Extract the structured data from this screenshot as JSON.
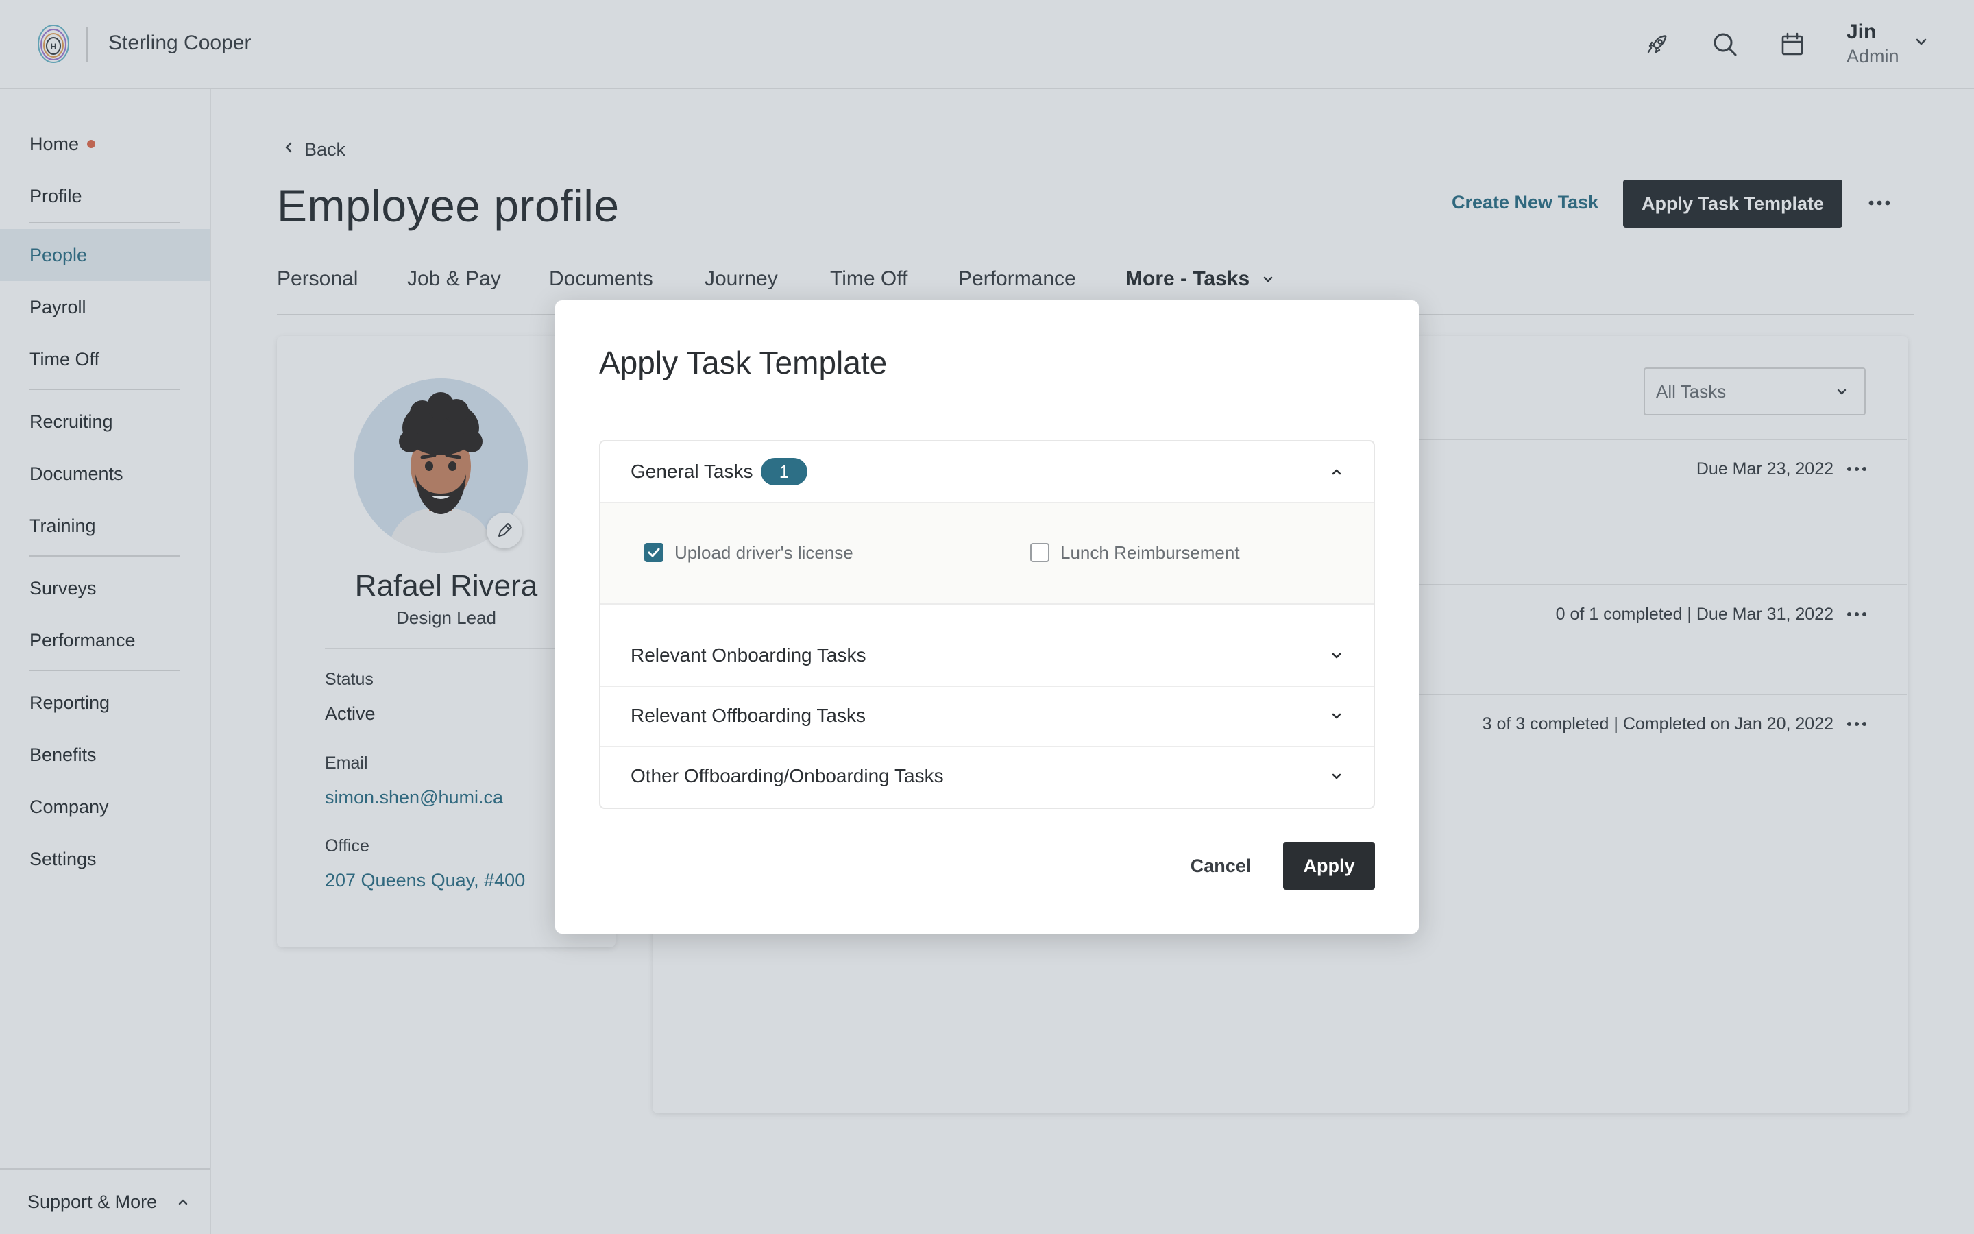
{
  "app": {
    "company": "Sterling Cooper"
  },
  "user": {
    "name": "Jin",
    "role": "Admin"
  },
  "sidebar": {
    "items": [
      {
        "label": "Home",
        "dot": true
      },
      {
        "label": "Profile"
      },
      {
        "label": "People",
        "active": true
      },
      {
        "label": "Payroll"
      },
      {
        "label": "Time Off"
      },
      {
        "label": "Recruiting"
      },
      {
        "label": "Documents"
      },
      {
        "label": "Training"
      },
      {
        "label": "Surveys"
      },
      {
        "label": "Performance"
      },
      {
        "label": "Reporting"
      },
      {
        "label": "Benefits"
      },
      {
        "label": "Company"
      },
      {
        "label": "Settings"
      }
    ],
    "support_label": "Support & More"
  },
  "page": {
    "back_label": "Back",
    "title": "Employee profile",
    "create_task_label": "Create New Task",
    "apply_template_label": "Apply Task Template"
  },
  "tabs": [
    {
      "label": "Personal"
    },
    {
      "label": "Job & Pay"
    },
    {
      "label": "Documents"
    },
    {
      "label": "Journey"
    },
    {
      "label": "Time Off"
    },
    {
      "label": "Performance"
    },
    {
      "label": "More - Tasks",
      "active": true
    }
  ],
  "profile": {
    "name": "Rafael Rivera",
    "role": "Design Lead",
    "status_label": "Status",
    "status_value": "Active",
    "email_label": "Email",
    "email_value": "simon.shen@humi.ca",
    "office_label": "Office",
    "office_value": "207 Queens Quay, #400"
  },
  "tasks": {
    "filter_value": "All Tasks",
    "rows": [
      {
        "meta": "Due Mar 23, 2022"
      },
      {
        "meta": "0 of 1 completed  |  Due Mar 31, 2022"
      },
      {
        "meta": "3 of 3 completed  |  Completed on Jan 20, 2022"
      }
    ]
  },
  "modal": {
    "title": "Apply Task Template",
    "sections": [
      {
        "title": "General Tasks",
        "badge": "1",
        "expanded": true,
        "items": [
          {
            "label": "Upload driver's license",
            "checked": true
          },
          {
            "label": "Lunch Reimbursement",
            "checked": false
          }
        ]
      },
      {
        "title": "Relevant Onboarding Tasks",
        "expanded": false
      },
      {
        "title": "Relevant Offboarding Tasks",
        "expanded": false
      },
      {
        "title": "Other Offboarding/Onboarding Tasks",
        "expanded": false
      }
    ],
    "cancel_label": "Cancel",
    "apply_label": "Apply"
  },
  "colors": {
    "accent": "#2d6f86",
    "dark_button": "#2b2f33",
    "notification_dot": "#e06b4e",
    "overlay": "#3d4e62"
  }
}
